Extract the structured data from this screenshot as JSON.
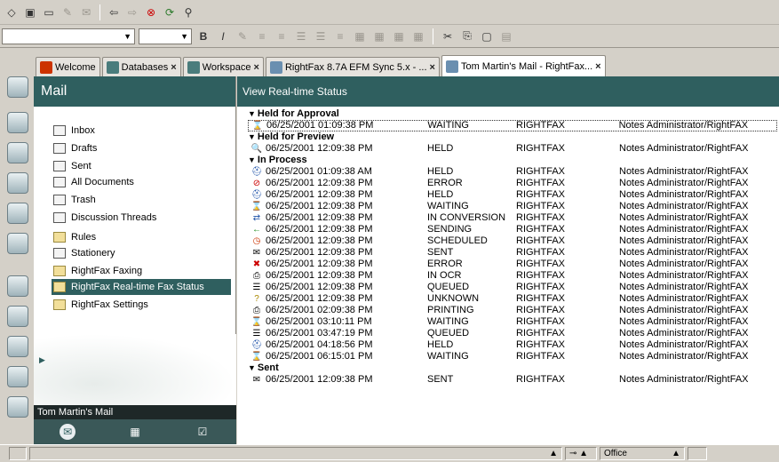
{
  "toolbar": {
    "bold_label": "B",
    "italic_label": "I"
  },
  "tabs": [
    {
      "label": "Welcome",
      "icon": "home-icon",
      "color": "#cc3300"
    },
    {
      "label": "Databases",
      "icon": "databases-icon",
      "color": "#4a7c7c"
    },
    {
      "label": "Workspace",
      "icon": "workspace-icon",
      "color": "#4a7c7c"
    },
    {
      "label": "RightFax 8.7A EFM Sync 5.x - ...",
      "icon": "document-icon",
      "color": "#6a8fb0"
    },
    {
      "label": "Tom Martin's Mail - RightFax...",
      "icon": "mail-tab-icon",
      "color": "#6a8fb0"
    }
  ],
  "nav": {
    "title": "Mail",
    "items": [
      {
        "label": "Inbox",
        "icon": "inbox-icon"
      },
      {
        "label": "Drafts",
        "icon": "drafts-icon"
      },
      {
        "label": "Sent",
        "icon": "sent-icon"
      },
      {
        "label": "All Documents",
        "icon": "all-documents-icon"
      },
      {
        "label": "Trash",
        "icon": "trash-icon"
      },
      {
        "label": "Discussion Threads",
        "icon": "threads-icon"
      },
      {
        "label": "Rules",
        "icon": "folder-icon"
      },
      {
        "label": "Stationery",
        "icon": "stationery-icon"
      },
      {
        "label": "RightFax Faxing",
        "icon": "folder-icon"
      },
      {
        "label": "RightFax Real-time Fax Status",
        "icon": "folder-icon",
        "selected": true
      },
      {
        "label": "RightFax Settings",
        "icon": "folder-icon"
      }
    ],
    "footer_label": "Tom Martin's Mail"
  },
  "main": {
    "title": "View Real-time Status",
    "groups": [
      {
        "label": "Held for Approval",
        "rows": [
          {
            "icon": "⌛",
            "icon_name": "hourglass-icon",
            "date": "06/25/2001 01:09:38 PM",
            "status": "WAITING",
            "server": "RIGHTFAX",
            "user": "Notes Administrator/RightFAX",
            "boxed": true
          }
        ]
      },
      {
        "label": "Held for Preview",
        "rows": [
          {
            "icon": "🔍",
            "icon_name": "preview-icon",
            "date": "06/25/2001 12:09:38 PM",
            "status": "HELD",
            "server": "RIGHTFAX",
            "user": "Notes Administrator/RightFAX"
          }
        ]
      },
      {
        "label": "In Process",
        "rows": [
          {
            "icon": "⛑",
            "icon_name": "held-icon",
            "date": "06/25/2001 01:09:38 AM",
            "status": "HELD",
            "server": "RIGHTFAX",
            "user": "Notes Administrator/RightFAX"
          },
          {
            "icon": "⊘",
            "icon_name": "error-icon",
            "date": "06/25/2001 12:09:38 PM",
            "status": "ERROR",
            "server": "RIGHTFAX",
            "user": "Notes Administrator/RightFAX"
          },
          {
            "icon": "⛑",
            "icon_name": "held-icon",
            "date": "06/25/2001 12:09:38 PM",
            "status": "HELD",
            "server": "RIGHTFAX",
            "user": "Notes Administrator/RightFAX"
          },
          {
            "icon": "⌛",
            "icon_name": "hourglass-icon",
            "date": "06/25/2001 12:09:38 PM",
            "status": "WAITING",
            "server": "RIGHTFAX",
            "user": "Notes Administrator/RightFAX"
          },
          {
            "icon": "⇄",
            "icon_name": "conversion-icon",
            "date": "06/25/2001 12:09:38 PM",
            "status": "IN CONVERSION",
            "server": "RIGHTFAX",
            "user": "Notes Administrator/RightFAX"
          },
          {
            "icon": "←",
            "icon_name": "sending-icon",
            "date": "06/25/2001 12:09:38 PM",
            "status": "SENDING",
            "server": "RIGHTFAX",
            "user": "Notes Administrator/RightFAX"
          },
          {
            "icon": "◷",
            "icon_name": "clock-icon",
            "date": "06/25/2001 12:09:38 PM",
            "status": "SCHEDULED",
            "server": "RIGHTFAX",
            "user": "Notes Administrator/RightFAX"
          },
          {
            "icon": "✉",
            "icon_name": "sent-status-icon",
            "date": "06/25/2001 12:09:38 PM",
            "status": "SENT",
            "server": "RIGHTFAX",
            "user": "Notes Administrator/RightFAX"
          },
          {
            "icon": "✖",
            "icon_name": "error-x-icon",
            "date": "06/25/2001 12:09:38 PM",
            "status": "ERROR",
            "server": "RIGHTFAX",
            "user": "Notes Administrator/RightFAX"
          },
          {
            "icon": "⎙",
            "icon_name": "ocr-icon",
            "date": "06/25/2001 12:09:38 PM",
            "status": "IN OCR",
            "server": "RIGHTFAX",
            "user": "Notes Administrator/RightFAX"
          },
          {
            "icon": "☰",
            "icon_name": "queued-icon",
            "date": "06/25/2001 12:09:38 PM",
            "status": "QUEUED",
            "server": "RIGHTFAX",
            "user": "Notes Administrator/RightFAX"
          },
          {
            "icon": "?",
            "icon_name": "unknown-icon",
            "date": "06/25/2001 12:09:38 PM",
            "status": "UNKNOWN",
            "server": "RIGHTFAX",
            "user": "Notes Administrator/RightFAX"
          },
          {
            "icon": "⎙",
            "icon_name": "printing-icon",
            "date": "06/25/2001 02:09:38 PM",
            "status": "PRINTING",
            "server": "RIGHTFAX",
            "user": "Notes Administrator/RightFAX"
          },
          {
            "icon": "⌛",
            "icon_name": "hourglass-icon",
            "date": "06/25/2001 03:10:11 PM",
            "status": "WAITING",
            "server": "RIGHTFAX",
            "user": "Notes Administrator/RightFAX"
          },
          {
            "icon": "☰",
            "icon_name": "queued-icon",
            "date": "06/25/2001 03:47:19 PM",
            "status": "QUEUED",
            "server": "RIGHTFAX",
            "user": "Notes Administrator/RightFAX"
          },
          {
            "icon": "⛑",
            "icon_name": "held-icon",
            "date": "06/25/2001 04:18:56 PM",
            "status": "HELD",
            "server": "RIGHTFAX",
            "user": "Notes Administrator/RightFAX"
          },
          {
            "icon": "⌛",
            "icon_name": "hourglass-icon",
            "date": "06/25/2001 06:15:01 PM",
            "status": "WAITING",
            "server": "RIGHTFAX",
            "user": "Notes Administrator/RightFAX"
          }
        ]
      },
      {
        "label": "Sent",
        "rows": [
          {
            "icon": "✉",
            "icon_name": "sent-status-icon",
            "date": "06/25/2001 12:09:38 PM",
            "status": "SENT",
            "server": "RIGHTFAX",
            "user": "Notes Administrator/RightFAX"
          }
        ]
      }
    ]
  },
  "statusbar": {
    "location": "Office"
  }
}
